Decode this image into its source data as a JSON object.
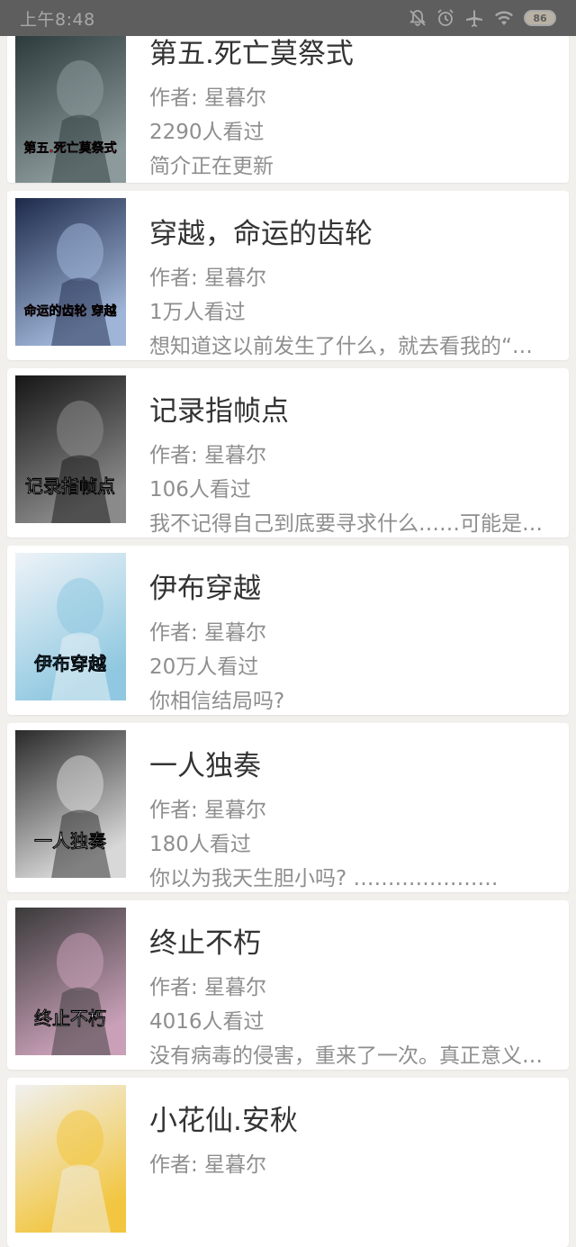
{
  "status_bar": {
    "time": "上午8:48",
    "icons": [
      "bell-off-icon",
      "alarm-icon",
      "airplane-icon",
      "wifi-icon"
    ],
    "battery": "86"
  },
  "books": [
    {
      "title": "第五.死亡莫祭式",
      "author": "作者: 星暮尔",
      "views": "2290人看过",
      "desc": "简介正在更新",
      "cover_text": "第五.死亡莫祭式",
      "cover_colors": [
        "#2c3a3c",
        "#8c9a9c"
      ],
      "cover_accent": "#c0263a"
    },
    {
      "title": "穿越，命运的齿轮",
      "author": "作者: 星暮尔",
      "views": "1万人看过",
      "desc": "想知道这以前发生了什么，就去看我的“第五.死亡莫祭式”",
      "cover_text": "命运的齿轮 穿越",
      "cover_colors": [
        "#1e2a4a",
        "#9fb5d8"
      ],
      "cover_accent": "#c0263a"
    },
    {
      "title": "记录指帧点",
      "author": "作者: 星暮尔",
      "views": "106人看过",
      "desc": "我不记得自己到底要寻求什么……可能是答案吧",
      "cover_text": "记录指帧点",
      "cover_colors": [
        "#161616",
        "#8a8a8a"
      ],
      "cover_accent": "#e0e0e0"
    },
    {
      "title": "伊布穿越",
      "author": "作者: 星暮尔",
      "views": "20万人看过",
      "desc": "你相信结局吗?",
      "cover_text": "伊布穿越",
      "cover_colors": [
        "#eef3f8",
        "#8fc8e0"
      ],
      "cover_accent": "#3a8fc0"
    },
    {
      "title": "一人独奏",
      "author": "作者: 星暮尔",
      "views": "180人看过",
      "desc": "你以为我天生胆小吗? …………………",
      "cover_text": "一人独奏",
      "cover_colors": [
        "#2a2a2a",
        "#d8d8d8"
      ],
      "cover_accent": "#ffffff"
    },
    {
      "title": "终止不朽",
      "author": "作者: 星暮尔",
      "views": "4016人看过",
      "desc": "没有病毒的侵害，重来了一次。真正意义上的重来",
      "cover_text": "终止不朽",
      "cover_colors": [
        "#3a3a3a",
        "#c9a0b8"
      ],
      "cover_accent": "#ffffff"
    },
    {
      "title": "小花仙.安秋",
      "author": "作者: 星暮尔",
      "views": "",
      "desc": "",
      "cover_text": "",
      "cover_colors": [
        "#f0f0f0",
        "#f2c640"
      ],
      "cover_accent": "#e8a020"
    }
  ]
}
